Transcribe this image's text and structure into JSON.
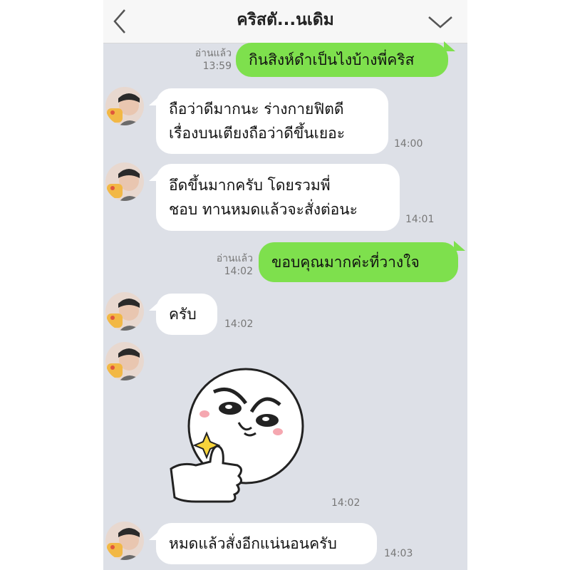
{
  "header": {
    "title": "คริสตั...นเดิม",
    "back_icon": "chevron-left-icon",
    "menu_icon": "chevron-down-icon"
  },
  "colors": {
    "outgoing_bubble": "#7ee04d",
    "incoming_bubble": "#ffffff",
    "chat_background": "#dde0e7"
  },
  "messages": [
    {
      "direction": "out",
      "text_lines": [
        "กินสิงห์ดำเป็นไงบ้างพี่คริส"
      ],
      "read": "อ่านแล้ว",
      "time": "13:59"
    },
    {
      "direction": "in",
      "text_lines": [
        "ถือว่าดีมากนะ ร่างกายฟิตดี",
        "เรื่องบนเตียงถือว่าดีขึ้นเยอะ"
      ],
      "time": "14:00"
    },
    {
      "direction": "in",
      "text_lines": [
        "อึดขึ้นมากครับ  โดยรวมพี่",
        "ชอบ ทานหมดแล้วจะสั่งต่อนะ"
      ],
      "time": "14:01"
    },
    {
      "direction": "out",
      "text_lines": [
        "ขอบคุณมากค่ะที่วางใจ"
      ],
      "read": "อ่านแล้ว",
      "time": "14:02"
    },
    {
      "direction": "in",
      "text_lines": [
        "ครับ"
      ],
      "time": "14:02"
    },
    {
      "direction": "in",
      "sticker": "thumbs-up-sticker",
      "time": "14:02"
    },
    {
      "direction": "in",
      "text_lines": [
        "หมดแล้วสั่งอีกแน่นอนครับ"
      ],
      "time": "14:03"
    }
  ]
}
